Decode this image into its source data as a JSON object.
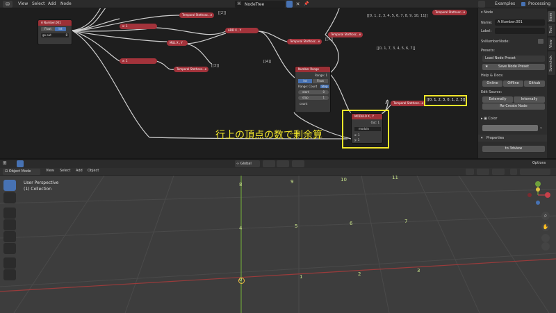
{
  "node_editor": {
    "menu": [
      "View",
      "Select",
      "Add",
      "Node"
    ],
    "tree_name": "NodeTree",
    "right_header": [
      "Examples",
      "Processing"
    ],
    "annotation": "行上の頂点の数で剰余算",
    "nodes": {
      "a_number": {
        "title": "A Number.001",
        "mode_a": "Float",
        "mode_b": "Int",
        "socket": "go out",
        "value": "8"
      },
      "x1a": "x: 1",
      "mul": "MUL X , Y",
      "add": "ADD X , Y",
      "x1b": "x: 1",
      "modulo_node": {
        "title": "MODULO X , Y",
        "out": "Out: 1",
        "mode": "modulo",
        "in1": "x: 1",
        "in2": "y: 1"
      },
      "number_range": {
        "title": "Number Range",
        "label": "Range: 1",
        "int": "Int",
        "float": "Float",
        "range_label": "Range: Count",
        "step": "Step",
        "start": "start",
        "stop": "stop",
        "count": "count",
        "start_val": "0",
        "stop_val": "1"
      },
      "viewers": [
        "Temporal Stethosc...e",
        "Temporal Stethosc...e",
        "Temporal Stethosc...e",
        "Temporal Stethosc...e",
        "Temporal Stethosc...e",
        "Temporal Stethosc...e"
      ]
    },
    "viewer_outputs": [
      "[[2]]",
      "[[0, 1, 2, 3, 4, 5, 6, 7, 8, 9, 10, 11]]",
      "[[3]]",
      "[[0, 1, 7, 3, 4, 5, 6, 7]]",
      "[[4]]",
      "[[3]]",
      "[[0, 1, 2, 3, 0, 1, 2, 3]]"
    ]
  },
  "npanel": {
    "section_node": "Node",
    "name_label": "Name:",
    "name_value": "A Number.001",
    "label_label": "Label:",
    "sv_node": "SvNumberNode:",
    "presets_label": "Presets:",
    "load_preset": "Load Node Preset",
    "save_preset": "Save Node Preset",
    "help_label": "Help & Docs:",
    "help_buttons": [
      "Online",
      "Offline",
      "Github"
    ],
    "edit_label": "Edit Source:",
    "edit_buttons": [
      "Externally",
      "Internally"
    ],
    "recreate": "Re-Create Node",
    "color_label": "Color",
    "properties_label": "Properties",
    "to_3dview": "to 3dview",
    "tabs": [
      "Item",
      "Tool",
      "View",
      "Sverchok"
    ]
  },
  "viewport": {
    "mode": "Object Mode",
    "menu": [
      "View",
      "Select",
      "Add",
      "Object"
    ],
    "transform": "Global",
    "options": "Options",
    "view_name": "User Perspective",
    "collection": "(1) Collection",
    "grid_labels": [
      "0",
      "1",
      "2",
      "3",
      "4",
      "5",
      "6",
      "7",
      "8",
      "9",
      "10",
      "11"
    ]
  }
}
